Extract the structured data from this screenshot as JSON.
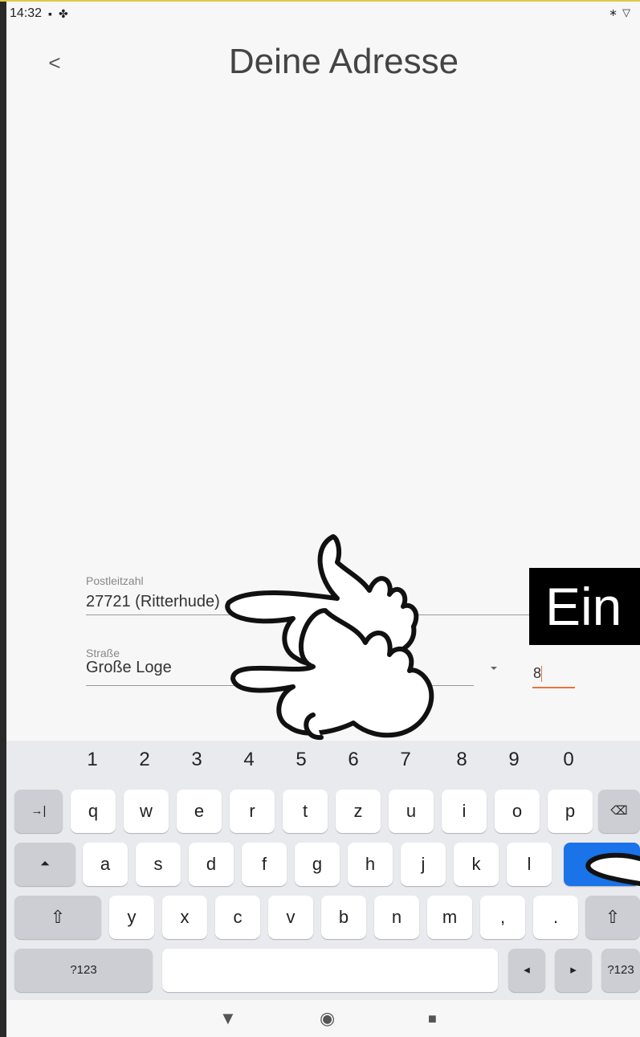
{
  "status_bar": {
    "time": "14:32",
    "left_icons": [
      "image-icon",
      "fan-icon"
    ],
    "right_icons": [
      "bluetooth-icon",
      "wifi-icon"
    ]
  },
  "header": {
    "back_label": "<",
    "title": "Deine Adresse"
  },
  "form": {
    "postcode_label": "Postleitzahl",
    "postcode_value": "27721 (Ritterhude)",
    "street_label": "Straße",
    "street_value": "Große Loge",
    "street_dropdown_icon": "dropdown-arrow-icon",
    "house_number_value": "8"
  },
  "overlay": {
    "text": "Ein"
  },
  "keyboard": {
    "number_row": [
      "1",
      "2",
      "3",
      "4",
      "5",
      "6",
      "7",
      "8",
      "9",
      "0"
    ],
    "row1": [
      "q",
      "w",
      "e",
      "r",
      "t",
      "z",
      "u",
      "i",
      "o",
      "p"
    ],
    "row2": [
      "a",
      "s",
      "d",
      "f",
      "g",
      "h",
      "j",
      "k",
      "l"
    ],
    "row3": [
      "y",
      "x",
      "c",
      "v",
      "b",
      "n",
      "m",
      ",",
      "."
    ],
    "tab_label": "→|",
    "backspace_label": "⌫",
    "caps_label": "⏶",
    "shift_label": "⇧",
    "symbols_label": "?123",
    "left_arrow": "◂",
    "right_arrow": "▸",
    "enter_color": "#1a73e8"
  },
  "navigation_bar": {
    "back": "▼",
    "home": "◉",
    "recents": "■"
  },
  "colors": {
    "accent": "#e8743a",
    "background": "#f7f7f7"
  }
}
